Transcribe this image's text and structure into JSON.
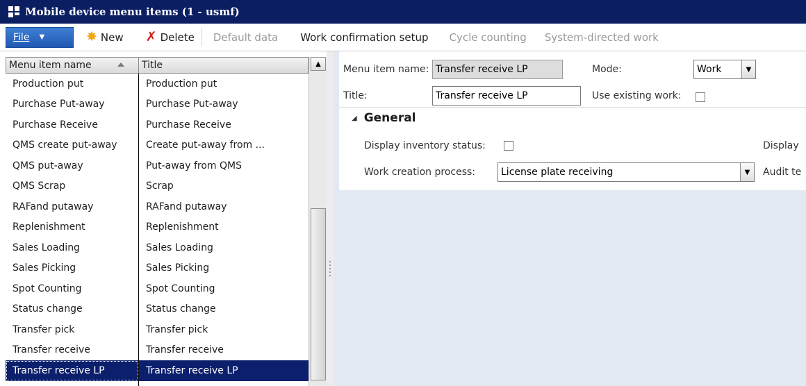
{
  "window": {
    "title": "Mobile device menu items (1 - usmf)",
    "title_bg": "#0b1e62"
  },
  "toolbar": {
    "file_label": "File",
    "new_label": "New",
    "delete_label": "Delete",
    "default_data_label": "Default data",
    "work_confirmation_label": "Work confirmation setup",
    "cycle_counting_label": "Cycle counting",
    "system_directed_label": "System-directed work"
  },
  "list": {
    "col1_header": "Menu item name",
    "col2_header": "Title",
    "rows": [
      {
        "name": "Production put",
        "title": "Production put"
      },
      {
        "name": "Purchase Put-away",
        "title": "Purchase Put-away"
      },
      {
        "name": "Purchase Receive",
        "title": "Purchase Receive"
      },
      {
        "name": "QMS create put-away",
        "title": "Create put-away from ..."
      },
      {
        "name": "QMS put-away",
        "title": "Put-away from QMS"
      },
      {
        "name": "QMS Scrap",
        "title": "Scrap"
      },
      {
        "name": "RAFand putaway",
        "title": "RAFand putaway"
      },
      {
        "name": "Replenishment",
        "title": "Replenishment"
      },
      {
        "name": "Sales Loading",
        "title": "Sales Loading"
      },
      {
        "name": "Sales Picking",
        "title": "Sales Picking"
      },
      {
        "name": "Spot Counting",
        "title": "Spot Counting"
      },
      {
        "name": "Status change",
        "title": "Status change"
      },
      {
        "name": "Transfer pick",
        "title": "Transfer pick"
      },
      {
        "name": "Transfer receive",
        "title": "Transfer receive"
      },
      {
        "name": "Transfer receive LP",
        "title": "Transfer receive LP",
        "selected": true
      }
    ],
    "selected_bg": "#0c1f6c"
  },
  "details": {
    "menu_item_name_label": "Menu item name:",
    "menu_item_name_value": "Transfer receive LP",
    "title_label": "Title:",
    "title_value": "Transfer receive LP",
    "mode_label": "Mode:",
    "mode_value": "Work",
    "use_existing_work_label": "Use existing work:",
    "use_existing_work_checked": false,
    "general_group_label": "General",
    "display_inventory_status_label": "Display inventory status:",
    "display_inventory_status_checked": false,
    "work_creation_process_label": "Work creation process:",
    "work_creation_process_value": "License plate receiving",
    "display_cut_label": "Display",
    "audit_cut_label": "Audit te"
  }
}
